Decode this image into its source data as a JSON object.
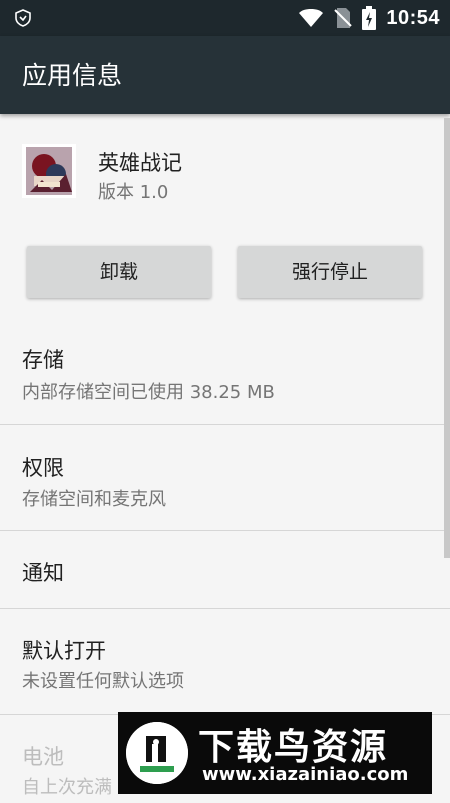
{
  "status_bar": {
    "time": "10:54",
    "icons": [
      "shield-icon",
      "wifi-icon",
      "no-sim-icon",
      "battery-charging-icon"
    ]
  },
  "app_bar": {
    "title": "应用信息"
  },
  "app": {
    "name": "英雄战记",
    "version": "版本 1.0",
    "icon": "app-icon"
  },
  "buttons": {
    "uninstall": "卸载",
    "force_stop": "强行停止"
  },
  "settings": [
    {
      "title": "存储",
      "subtitle": "内部存储空间已使用 38.25 MB"
    },
    {
      "title": "权限",
      "subtitle": "存储空间和麦克风"
    },
    {
      "title": "通知"
    },
    {
      "title": "默认打开",
      "subtitle": "未设置任何默认选项"
    },
    {
      "title": "电池",
      "subtitle": "自上次充满"
    }
  ],
  "watermark": {
    "title": "下载鸟资源",
    "url": "www.xiazainiao.com"
  },
  "colors": {
    "status_bar": "#1e282d",
    "app_bar": "#263238",
    "background": "#f5f5f5",
    "button": "#d6d7d7"
  }
}
